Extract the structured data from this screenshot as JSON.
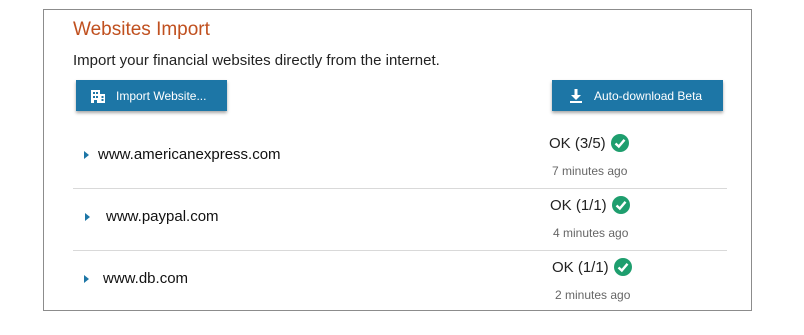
{
  "panel": {
    "title": "Websites Import",
    "subtitle": "Import your financial websites directly from the internet."
  },
  "buttons": {
    "import_label": "Import Website...",
    "import_icon": "building-icon",
    "auto_label": "Auto-download Beta",
    "auto_icon": "download-icon"
  },
  "colors": {
    "title": "#c0501f",
    "button": "#1d76a6",
    "check": "#1e9e6e"
  },
  "websites": [
    {
      "name": "www.americanexpress.com",
      "status": "OK (3/5)",
      "status_icon": "check-circle-icon",
      "time": "7 minutes ago"
    },
    {
      "name": "www.paypal.com",
      "status": "OK (1/1)",
      "status_icon": "check-circle-icon",
      "time": "4 minutes ago"
    },
    {
      "name": "www.db.com",
      "status": "OK (1/1)",
      "status_icon": "check-circle-icon",
      "time": "2 minutes ago"
    }
  ]
}
